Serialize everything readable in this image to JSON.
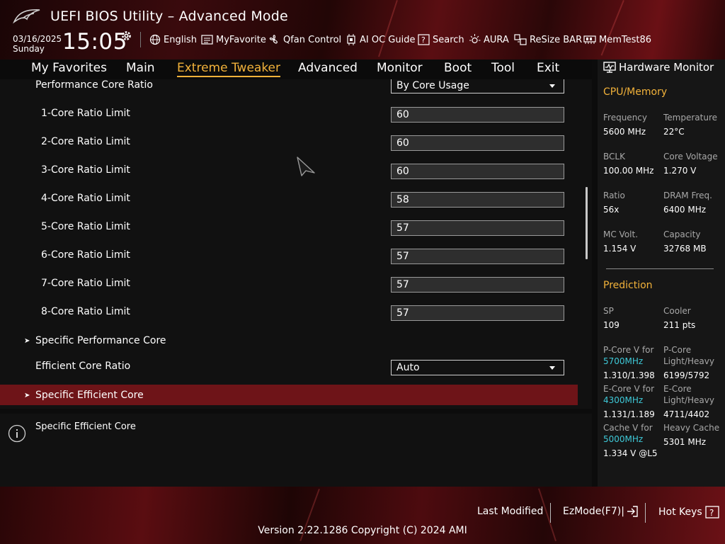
{
  "header": {
    "title": "UEFI BIOS Utility – Advanced Mode",
    "date": "03/16/2025",
    "day": "Sunday",
    "time": "15:05",
    "tools": [
      "English",
      "MyFavorite",
      "Qfan Control",
      "AI OC Guide",
      "Search",
      "AURA",
      "ReSize BAR",
      "MemTest86"
    ]
  },
  "nav": {
    "items": [
      "My Favorites",
      "Main",
      "Extreme Tweaker",
      "Advanced",
      "Monitor",
      "Boot",
      "Tool",
      "Exit"
    ],
    "active": "Extreme Tweaker"
  },
  "main": {
    "perf_core_ratio": {
      "label": "Performance Core Ratio",
      "value": "By Core Usage"
    },
    "core_limits": [
      {
        "label": "1-Core Ratio Limit",
        "value": "60"
      },
      {
        "label": "2-Core Ratio Limit",
        "value": "60"
      },
      {
        "label": "3-Core Ratio Limit",
        "value": "60"
      },
      {
        "label": "4-Core Ratio Limit",
        "value": "58"
      },
      {
        "label": "5-Core Ratio Limit",
        "value": "57"
      },
      {
        "label": "6-Core Ratio Limit",
        "value": "57"
      },
      {
        "label": "7-Core Ratio Limit",
        "value": "57"
      },
      {
        "label": "8-Core Ratio Limit",
        "value": "57"
      }
    ],
    "specific_perf_core": "Specific Performance Core",
    "eff_core_ratio": {
      "label": "Efficient Core Ratio",
      "value": "Auto"
    },
    "specific_eff_core": "Specific Efficient Core"
  },
  "help": {
    "text": "Specific Efficient Core"
  },
  "hw": {
    "title": "Hardware Monitor",
    "cpu_section": "CPU/Memory",
    "frequency": {
      "label": "Frequency",
      "value": "5600 MHz"
    },
    "temperature": {
      "label": "Temperature",
      "value": "22°C"
    },
    "bclk": {
      "label": "BCLK",
      "value": "100.00 MHz"
    },
    "core_voltage": {
      "label": "Core Voltage",
      "value": "1.270 V"
    },
    "ratio": {
      "label": "Ratio",
      "value": "56x"
    },
    "dram_freq": {
      "label": "DRAM Freq.",
      "value": "6400 MHz"
    },
    "mc_volt": {
      "label": "MC Volt.",
      "value": "1.154 V"
    },
    "capacity": {
      "label": "Capacity",
      "value": "32768 MB"
    },
    "prediction_section": "Prediction",
    "sp": {
      "label": "SP",
      "value": "109"
    },
    "cooler": {
      "label": "Cooler",
      "value": "211 pts"
    },
    "pcore_v": {
      "label": "P-Core V for",
      "freq": "5700MHz",
      "value": "1.310/1.398"
    },
    "pcore_lh": {
      "label1": "P-Core",
      "label2": "Light/Heavy",
      "value": "6199/5792"
    },
    "ecore_v": {
      "label": "E-Core V for",
      "freq": "4300MHz",
      "value": "1.131/1.189"
    },
    "ecore_lh": {
      "label1": "E-Core",
      "label2": "Light/Heavy",
      "value": "4711/4402"
    },
    "cache_v": {
      "label": "Cache V for",
      "freq": "5000MHz",
      "value": "1.334 V @L5"
    },
    "heavy_cache": {
      "label": "Heavy Cache",
      "value": "5301 MHz"
    }
  },
  "footer": {
    "last_modified": "Last Modified",
    "ezmode": "EzMode(F7)|",
    "hotkeys": "Hot Keys",
    "version": "Version 2.22.1286 Copyright (C) 2024 AMI"
  },
  "colors": {
    "accent": "#f2b23a",
    "highlight_row": "#6e1418",
    "cyan": "#3ec9d8"
  }
}
